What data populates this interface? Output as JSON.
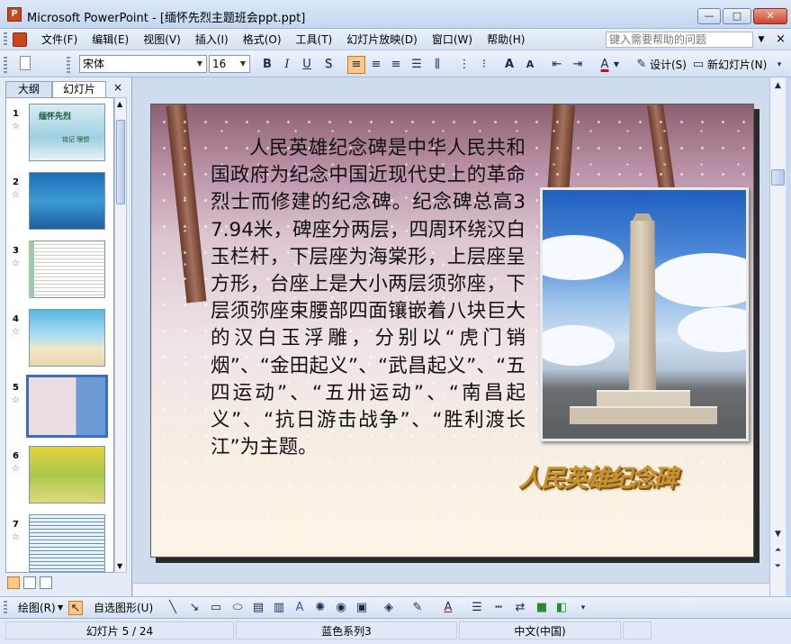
{
  "window": {
    "app_name": "Microsoft PowerPoint",
    "title": "Microsoft PowerPoint - [缅怀先烈主题班会ppt.ppt]",
    "min_label": "—",
    "max_label": "□",
    "close_label": "✕"
  },
  "menu": {
    "items": [
      {
        "label": "文件(F)"
      },
      {
        "label": "编辑(E)"
      },
      {
        "label": "视图(V)"
      },
      {
        "label": "插入(I)"
      },
      {
        "label": "格式(O)"
      },
      {
        "label": "工具(T)"
      },
      {
        "label": "幻灯片放映(D)"
      },
      {
        "label": "窗口(W)"
      },
      {
        "label": "帮助(H)"
      }
    ],
    "help_placeholder": "键入需要帮助的问题"
  },
  "toolbar": {
    "font_name": "宋体",
    "font_size": "16",
    "bold": "B",
    "italic": "I",
    "underline": "U",
    "shadow": "S",
    "design_label": "设计(S)",
    "new_slide_label": "新幻灯片(N)"
  },
  "left_panel": {
    "tab_outline": "大纲",
    "tab_slides": "幻灯片",
    "tab_close": "×",
    "thumbnails": [
      {
        "number": "1",
        "title": "缅怀先烈",
        "subtitle": "铭记 理想"
      },
      {
        "number": "2"
      },
      {
        "number": "3"
      },
      {
        "number": "4"
      },
      {
        "number": "5"
      },
      {
        "number": "6"
      },
      {
        "number": "7"
      }
    ],
    "selected_index": 5
  },
  "slide": {
    "body_text": "人民英雄纪念碑是中华人民共和国政府为纪念中国近现代史上的革命烈士而修建的纪念碑。纪念碑总高37.94米，碑座分两层，四周环绕汉白玉栏杆，下层座为海棠形，上层座呈方形，台座上是大小两层须弥座，下层须弥座束腰部四面镶嵌着八块巨大的汉白玉浮雕，分别以“虎门销烟”、“金田起义”、“武昌起义”、“五四运动”、“五卅运动”、“南昌起义”、“抗日游击战争”、“胜利渡长江”为主题。",
    "wordart_title": "人民英雄纪念碑"
  },
  "drawing_toolbar": {
    "draw_label": "绘图(R)",
    "autoshapes_label": "自选图形(U)"
  },
  "status": {
    "slide_position": "幻灯片 5 / 24",
    "design_name": "蓝色系列3",
    "language": "中文(中国)"
  },
  "colors": {
    "titlebar": "#c3d6ee",
    "selected_thumb_border": "#3b6ec0",
    "active_button": "#fcc787",
    "wordart": "#c8932f"
  }
}
